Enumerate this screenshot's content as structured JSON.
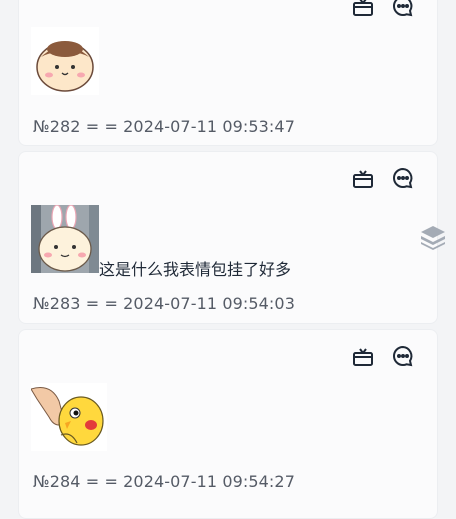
{
  "cards": [
    {
      "meta": "№282 = = 2024-07-11 09:53:47",
      "sticker": "hamster-sticker"
    },
    {
      "meta": "№283 = = 2024-07-11 09:54:03",
      "sticker": "bunny-ear-sticker",
      "text": "这是什么我表情包挂了好多"
    },
    {
      "meta": "№284 = = 2024-07-11 09:54:27",
      "sticker": "yellow-bird-sticker"
    }
  ],
  "icons": {
    "reply": "gift-icon",
    "comment": "comment-icon",
    "float": "layers-icon"
  },
  "colors": {
    "card_bg": "#fbfbfc",
    "meta_text": "#555b66",
    "icon": "#1f2937",
    "float_icon": "#9aa1ab"
  }
}
